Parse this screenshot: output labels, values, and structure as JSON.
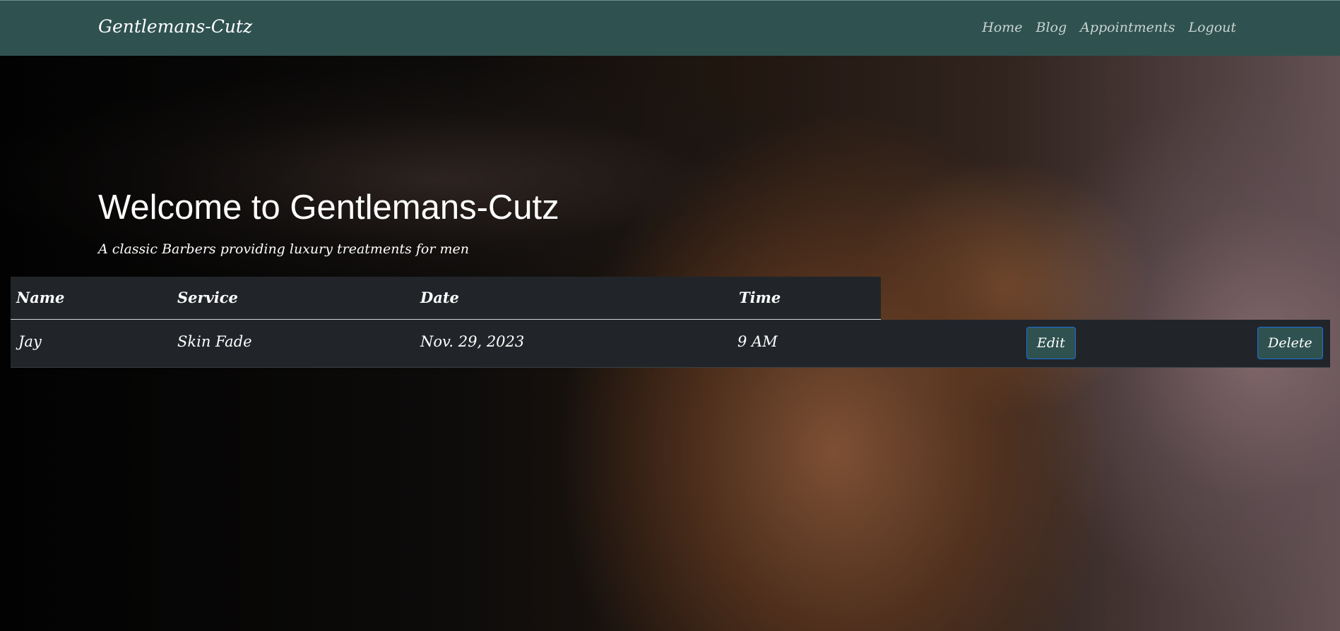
{
  "navbar": {
    "brand": "Gentlemans-Cutz",
    "links": [
      "Home",
      "Blog",
      "Appointments",
      "Logout"
    ]
  },
  "hero": {
    "title": "Welcome to Gentlemans-Cutz",
    "subtitle": "A classic Barbers providing luxury treatments for men"
  },
  "appointments": {
    "headers": [
      "Name",
      "Service",
      "Date",
      "Time"
    ],
    "rows": [
      {
        "name": "Jay",
        "service": "Skin Fade",
        "date": "Nov. 29, 2023",
        "time": "9 AM",
        "edit_label": "Edit",
        "delete_label": "Delete"
      }
    ]
  }
}
